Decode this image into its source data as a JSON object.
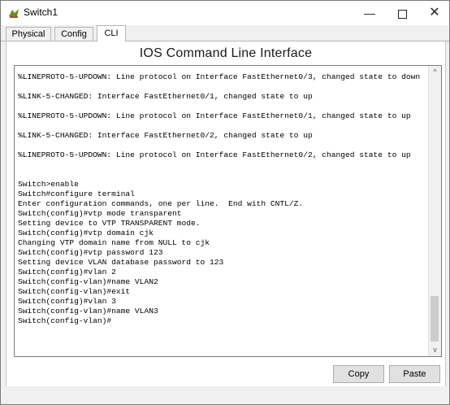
{
  "window": {
    "title": "Switch1"
  },
  "window_controls": {
    "minimize": "—",
    "maximize": "",
    "close": "✕"
  },
  "tabs": [
    {
      "label": "Physical"
    },
    {
      "label": "Config"
    },
    {
      "label": "CLI",
      "active": true
    }
  ],
  "cli": {
    "heading": "IOS Command Line Interface",
    "output": "%LINEPROTO-5-UPDOWN: Line protocol on Interface FastEthernet0/3, changed state to down\n\n%LINK-5-CHANGED: Interface FastEthernet0/1, changed state to up\n\n%LINEPROTO-5-UPDOWN: Line protocol on Interface FastEthernet0/1, changed state to up\n\n%LINK-5-CHANGED: Interface FastEthernet0/2, changed state to up\n\n%LINEPROTO-5-UPDOWN: Line protocol on Interface FastEthernet0/2, changed state to up\n\n\nSwitch>enable\nSwitch#configure terminal\nEnter configuration commands, one per line.  End with CNTL/Z.\nSwitch(config)#vtp mode transparent\nSetting device to VTP TRANSPARENT mode.\nSwitch(config)#vtp domain cjk\nChanging VTP domain name from NULL to cjk\nSwitch(config)#vtp password 123\nSetting device VLAN database password to 123\nSwitch(config)#vlan 2\nSwitch(config-vlan)#name VLAN2\nSwitch(config-vlan)#exit\nSwitch(config)#vlan 3\nSwitch(config-vlan)#name VLAN3\nSwitch(config-vlan)#"
  },
  "buttons": {
    "copy": "Copy",
    "paste": "Paste"
  },
  "scrollbar": {
    "up": "^",
    "down": "v"
  }
}
